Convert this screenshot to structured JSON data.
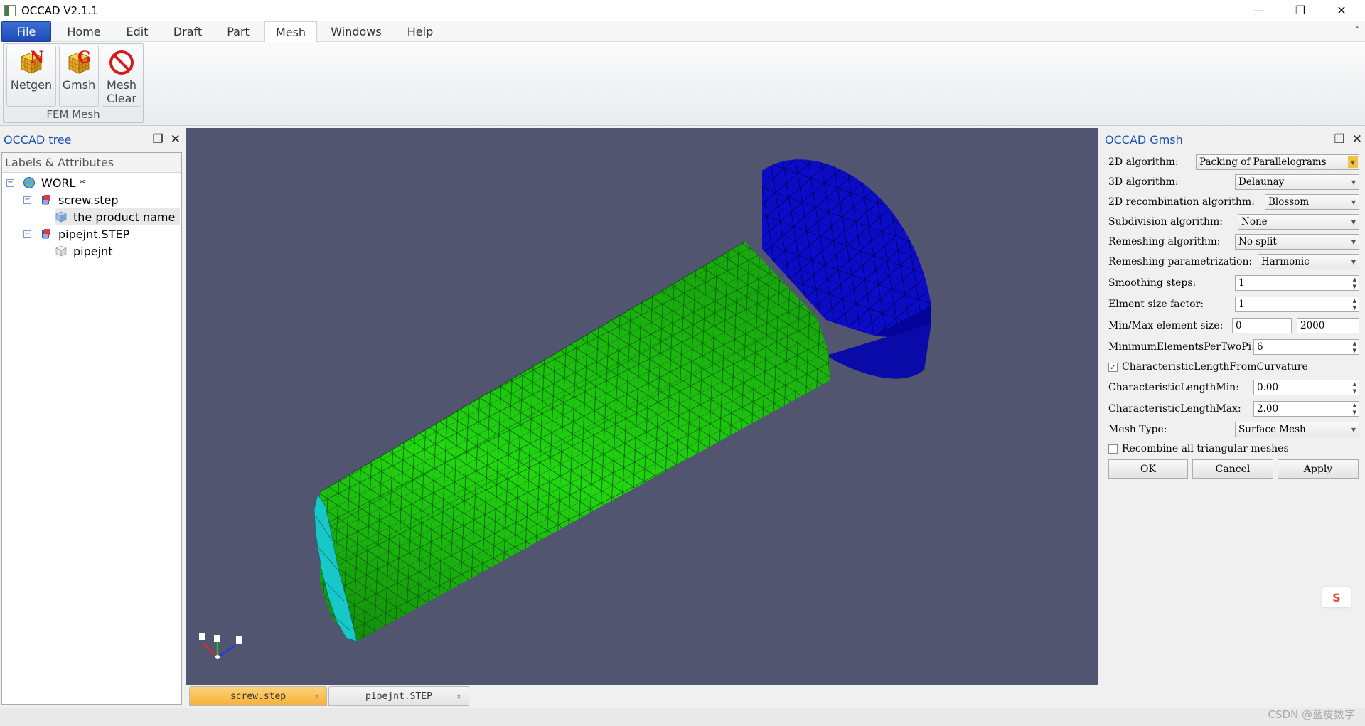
{
  "window": {
    "title": "OCCAD V2.1.1",
    "minimize": "—",
    "restore": "❐",
    "close": "✕"
  },
  "menu": {
    "tabs": [
      {
        "label": "File"
      },
      {
        "label": "Home"
      },
      {
        "label": "Edit"
      },
      {
        "label": "Draft"
      },
      {
        "label": "Part"
      },
      {
        "label": "Mesh"
      },
      {
        "label": "Windows"
      },
      {
        "label": "Help"
      }
    ],
    "active": "Mesh",
    "collapse_glyph": "⌃"
  },
  "ribbon": {
    "group_label": "FEM Mesh",
    "buttons": [
      {
        "label": "Netgen",
        "icon": "netgen-cube-icon",
        "letter": "N"
      },
      {
        "label": "Gmsh",
        "icon": "gmsh-cube-icon",
        "letter": "G"
      },
      {
        "label": "Mesh\nClear",
        "icon": "no-entry-icon"
      }
    ]
  },
  "left_dock": {
    "title": "OCCAD tree",
    "float_glyph": "❐",
    "close_glyph": "✕",
    "header": "Labels & Attributes",
    "nodes": [
      {
        "label": "WORL *",
        "icon": "globe-icon",
        "toggle": "−"
      },
      {
        "label": "screw.step",
        "icon": "assembly-icon",
        "toggle": "−"
      },
      {
        "label": "the product name",
        "icon": "part-cube-icon"
      },
      {
        "label": "pipejnt.STEP",
        "icon": "assembly-icon",
        "toggle": "−"
      },
      {
        "label": "pipejnt",
        "icon": "part-cube-outline-icon"
      }
    ]
  },
  "viewer": {
    "background": "#525570",
    "mesh_colors": {
      "shaft": "#22cc11",
      "head": "#0a0ac8",
      "end_face": "#1ac8c8"
    }
  },
  "doc_tabs": [
    {
      "label": "screw.step",
      "close": "✕",
      "active": true
    },
    {
      "label": "pipejnt.STEP",
      "close": "✕",
      "active": false
    }
  ],
  "right_dock": {
    "title": "OCCAD Gmsh",
    "float_glyph": "❐",
    "close_glyph": "✕",
    "fields": {
      "alg2d_label": "2D algorithm:",
      "alg2d_value": "Packing of Parallelograms",
      "alg3d_label": "3D algorithm:",
      "alg3d_value": "Delaunay",
      "recomb_label": "2D recombination algorithm:",
      "recomb_value": "Blossom",
      "subdiv_label": "Subdivision algorithm:",
      "subdiv_value": "None",
      "remesh_label": "Remeshing algorithm:",
      "remesh_value": "No split",
      "remeshparam_label": "Remeshing parametrization:",
      "remeshparam_value": "Harmonic",
      "smooth_label": "Smoothing steps:",
      "smooth_value": "1",
      "elsize_label": "Elment size factor:",
      "elsize_value": "1",
      "minmax_label": "Min/Max element size:",
      "min_value": "0",
      "max_value": "2000",
      "minelem_label": "MinimumElementsPerTwoPi:",
      "minelem_value": "6",
      "charcurv_label": "CharacteristicLengthFromCurvature",
      "charcurv_checked": "✓",
      "charmin_label": "CharacteristicLengthMin:",
      "charmin_value": "0.00",
      "charmax_label": "CharacteristicLengthMax:",
      "charmax_value": "2.00",
      "meshtype_label": "Mesh Type:",
      "meshtype_value": "Surface Mesh",
      "recombine_label": "Recombine all triangular meshes"
    },
    "buttons": {
      "ok": "OK",
      "cancel": "Cancel",
      "apply": "Apply"
    }
  },
  "overlay": {
    "side_widget": "S",
    "watermark": "CSDN @蓝皮数字"
  }
}
